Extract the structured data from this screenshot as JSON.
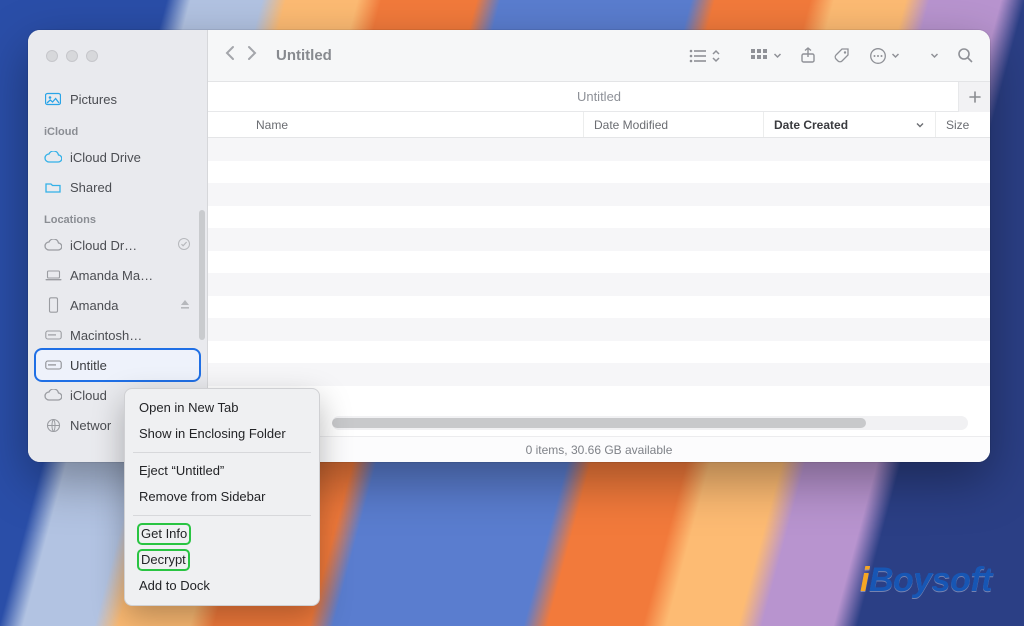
{
  "window": {
    "title": "Untitled",
    "path_label": "Untitled"
  },
  "toolbar": {
    "view_list": "list",
    "view_group": "group",
    "share": "share",
    "tags": "tags",
    "more": "more",
    "dropdown": "dropdown",
    "search": "search"
  },
  "sidebar": {
    "favorites": {
      "pictures": "Pictures"
    },
    "icloud_label": "iCloud",
    "icloud": {
      "drive": "iCloud Drive",
      "shared": "Shared"
    },
    "locations_label": "Locations",
    "locations": {
      "icloud_dr": "iCloud Dr…",
      "amanda_ma": "Amanda Ma…",
      "amanda": "Amanda",
      "macintosh": "Macintosh…",
      "untitled": "Untitle",
      "icloud": "iCloud",
      "network": "Networ"
    }
  },
  "columns": {
    "name": "Name",
    "modified": "Date Modified",
    "created": "Date Created",
    "size": "Size"
  },
  "status": "0 items, 30.66 GB available",
  "context_menu": {
    "open_tab": "Open in New Tab",
    "enclosing": "Show in Enclosing Folder",
    "eject": "Eject “Untitled”",
    "remove": "Remove from Sidebar",
    "get_info": "Get Info",
    "decrypt": "Decrypt",
    "add_dock": "Add to Dock"
  },
  "watermark": "iBoysoft"
}
